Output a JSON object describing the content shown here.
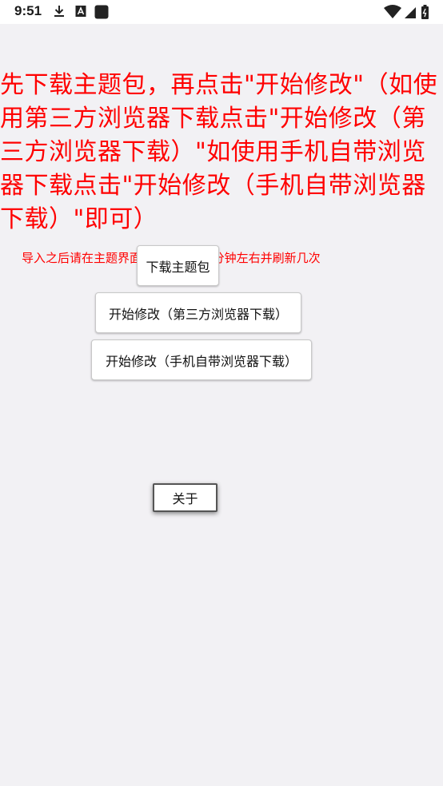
{
  "status_bar": {
    "time": "9:51",
    "icons": [
      "download-icon",
      "a-badge-icon",
      "square-icon",
      "wifi-icon",
      "signal-icon",
      "battery-icon"
    ]
  },
  "main": {
    "instruction": "先下载主题包，再点击\"开始修改\"（如使用第三方浏览器下载点击\"开始修改（第三方浏览器下载）\"如使用手机自带浏览器下载点击\"开始修改（手机自带浏览器下载）\"即可）",
    "note": "导入之后请在主题界面等待30秒～1分钟左右并刷新几次"
  },
  "buttons": {
    "download_theme": "下载主题包",
    "start_third_party": "开始修改（第三方浏览器下载）",
    "start_builtin": "开始修改（手机自带浏览器下载）",
    "about": "关于"
  },
  "colors": {
    "instruction_text": "#ff0000",
    "background": "#f2f1f4",
    "status_bar": "#ffffff"
  }
}
